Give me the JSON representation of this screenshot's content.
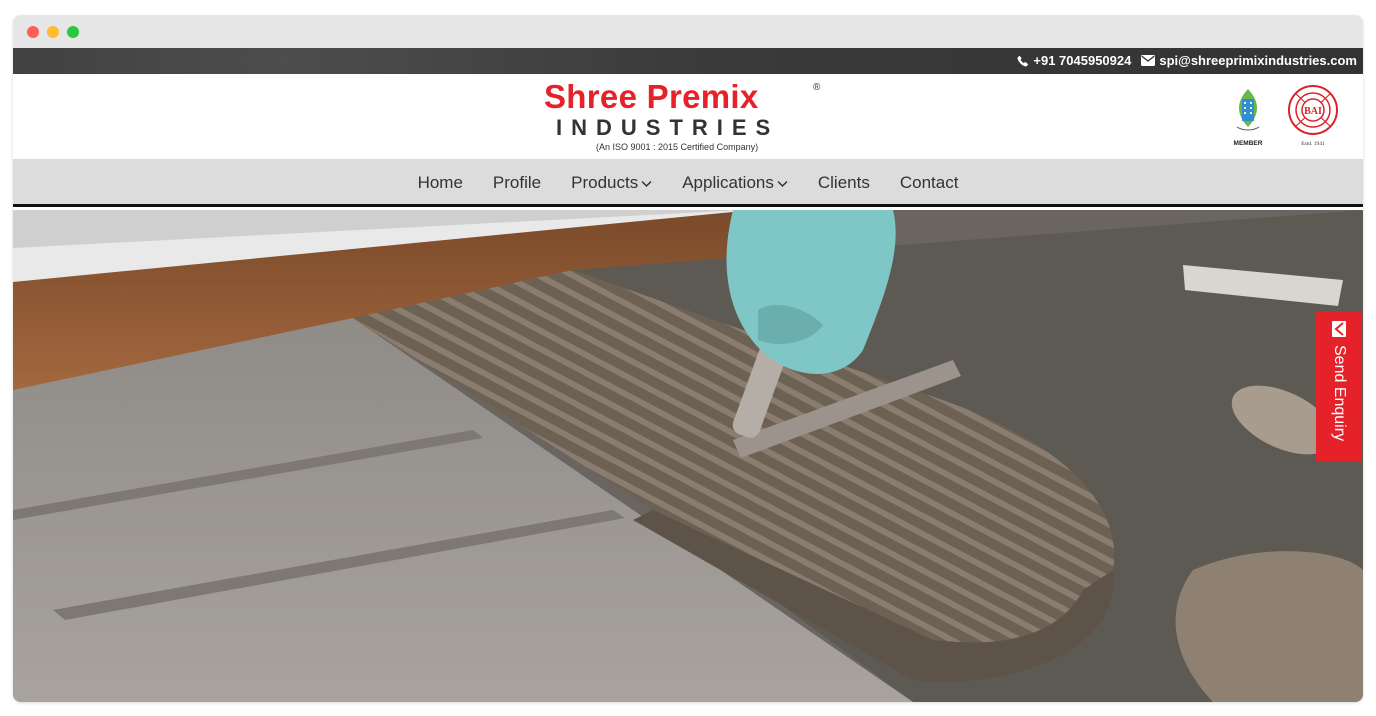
{
  "topbar": {
    "phone": "+91 7045950924",
    "email": "spi@shreeprimixindustries.com",
    "icons": [
      "phone-icon",
      "envelope-icon"
    ]
  },
  "logo": {
    "brand": "Shree Premix",
    "registered": "®",
    "subtitle": "INDUSTRIES",
    "certification": "(An ISO 9001 : 2015 Certified Company)"
  },
  "badges": {
    "member_label": "MEMBER",
    "bai_label": "BAI",
    "bai_est": "Estd. 1941"
  },
  "nav": {
    "items": [
      {
        "label": "Home"
      },
      {
        "label": "Profile"
      },
      {
        "label": "Products"
      },
      {
        "label": "Applications"
      },
      {
        "label": "Clients"
      },
      {
        "label": "Contact"
      }
    ],
    "dropdown_chevron": "⌵"
  },
  "enquiry": {
    "label": "Send Enquiry"
  },
  "colors": {
    "brand_red": "#e52229",
    "nav_bg": "#dcdcdc",
    "topbar_bg": "#3a3a3a"
  }
}
